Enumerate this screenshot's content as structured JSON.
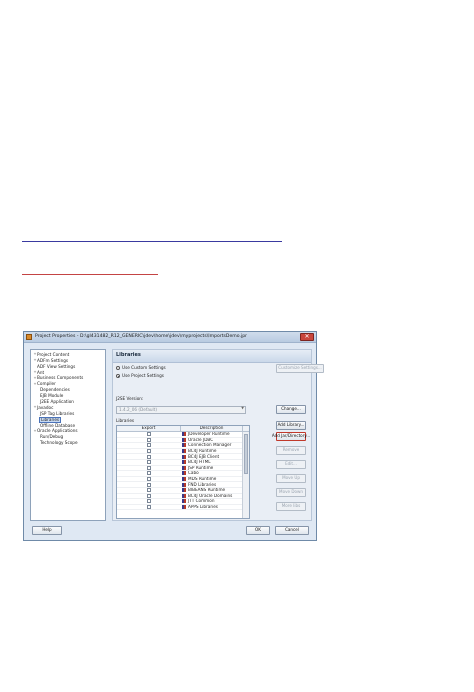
{
  "dialog": {
    "title": "Project Properties - D:\\gl431482_R12_GENERIC\\jdev\\home\\jdev\\myprojects\\ImportsDemo.jpr",
    "close_glyph": "✕"
  },
  "tree": {
    "items": [
      {
        "label": "Project Content",
        "expander": "+",
        "indent": 0,
        "selected": false
      },
      {
        "label": "ADFm Settings",
        "expander": "+",
        "indent": 0,
        "selected": false
      },
      {
        "label": "ADF View Settings",
        "expander": "",
        "indent": 0,
        "selected": false
      },
      {
        "label": "Ant",
        "expander": "+",
        "indent": 0,
        "selected": false
      },
      {
        "label": "Business Components",
        "expander": "+",
        "indent": 0,
        "selected": false
      },
      {
        "label": "Compiler",
        "expander": "+",
        "indent": 0,
        "selected": false
      },
      {
        "label": "Dependencies",
        "expander": "",
        "indent": 1,
        "selected": false
      },
      {
        "label": "EJB Module",
        "expander": "",
        "indent": 1,
        "selected": false
      },
      {
        "label": "J2EE Application",
        "expander": "",
        "indent": 1,
        "selected": false
      },
      {
        "label": "Javadoc",
        "expander": "+",
        "indent": 0,
        "selected": false
      },
      {
        "label": "JSP Tag Libraries",
        "expander": "",
        "indent": 1,
        "selected": false
      },
      {
        "label": "Libraries",
        "expander": "",
        "indent": 1,
        "selected": true
      },
      {
        "label": "Offline Database",
        "expander": "",
        "indent": 1,
        "selected": false
      },
      {
        "label": "Oracle Applications",
        "expander": "+",
        "indent": 0,
        "selected": false
      },
      {
        "label": "Run/Debug",
        "expander": "",
        "indent": 1,
        "selected": false
      },
      {
        "label": "Technology Scope",
        "expander": "",
        "indent": 1,
        "selected": false
      }
    ]
  },
  "panel": {
    "title": "Libraries",
    "use_custom_settings": "Use Custom Settings",
    "use_project_settings": "Use Project Settings",
    "customize_settings": "Customize Settings...",
    "j2se_version_label": "J2SE Version:",
    "j2se_version_value": "1.4.2_06 (Default)",
    "change_button": "Change...",
    "libraries_label": "Libraries",
    "columns": {
      "export": "Export",
      "description": "Description"
    },
    "libraries": [
      "JDeveloper Runtime",
      "Oracle JDBC",
      "Connection Manager",
      "BC4J Runtime",
      "BC4J EJB Client",
      "BC4J HTML",
      "JSP Runtime",
      "Cabo",
      "MDS Runtime",
      "FND Libraries",
      "BIBEANS Runtime",
      "BC4J Oracle Domains",
      "JTT Common",
      "APPS Libraries"
    ],
    "buttons": {
      "add_library": "Add Library...",
      "add_jar": "Add Jar/Directory...",
      "remove": "Remove",
      "edit": "Edit...",
      "move_up": "Move Up",
      "move_down": "Move Down",
      "more_libs": "More libs"
    }
  },
  "footer": {
    "help": "Help",
    "ok": "OK",
    "cancel": "Cancel"
  },
  "colors": {
    "rule_blue": "#3a3aa0",
    "rule_red": "#c44444",
    "focus_border": "#c0392b"
  }
}
